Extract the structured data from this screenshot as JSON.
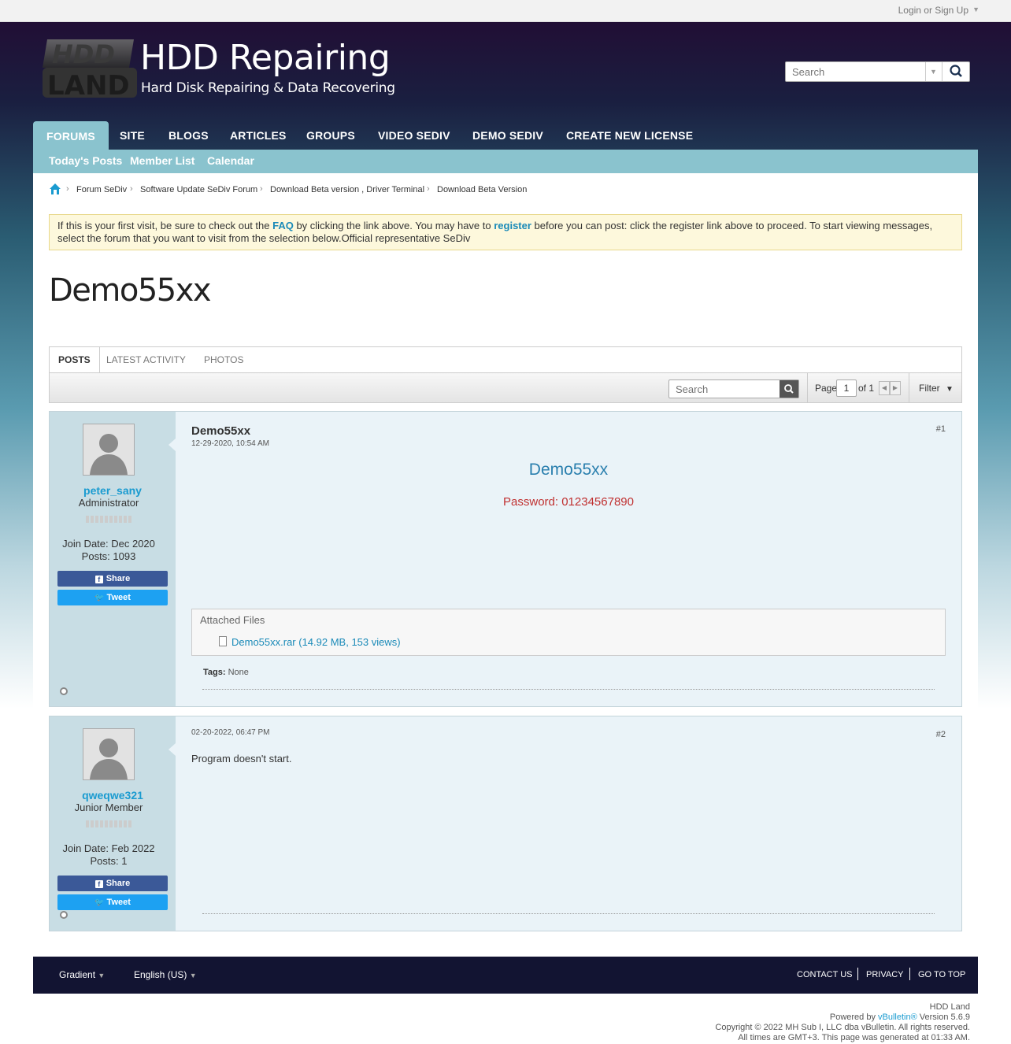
{
  "topbar": {
    "login_label": "Login or Sign Up"
  },
  "header": {
    "title": "HDD Repairing",
    "subtitle": "Hard Disk Repairing & Data Recovering",
    "search_placeholder": "Search"
  },
  "nav": {
    "tabs": [
      "FORUMS",
      "SITE",
      "BLOGS",
      "ARTICLES",
      "GROUPS",
      "VIDEO SEDIV",
      "DEMO SEDIV",
      "CREATE NEW LICENSE"
    ],
    "subtabs": [
      "Today's Posts",
      "Member List",
      "Calendar"
    ]
  },
  "breadcrumb": [
    "Forum SeDiv",
    "Software Update SeDiv Forum",
    "Download Beta version , Driver Terminal",
    "Download Beta Version"
  ],
  "notice": {
    "part1": "If this is your first visit, be sure to check out the ",
    "faq": "FAQ",
    "part2": " by clicking the link above. You may have to ",
    "register": "register",
    "part3": " before you can post: click the register link above to proceed. To start viewing messages, select the forum that you want to visit from the selection below.Official representative SeDiv"
  },
  "page_title": "Demo55xx",
  "tabs": [
    "POSTS",
    "LATEST ACTIVITY",
    "PHOTOS"
  ],
  "toolbar": {
    "search_placeholder": "Search",
    "page_label": "Page",
    "page_value": "1",
    "of_label": "of 1",
    "filter_label": "Filter"
  },
  "posts": [
    {
      "title": "Demo55xx",
      "date": "12-29-2020, 10:54 AM",
      "number": "#1",
      "username": "peter_sany",
      "role": "Administrator",
      "join_date": "Join Date: Dec 2020",
      "posts_count": "Posts: 1093",
      "share": "Share",
      "tweet": "Tweet",
      "content_title": "Demo55xx",
      "content_password": "Password: 01234567890",
      "attached_header": "Attached Files",
      "attached_file": "Demo55xx.rar (14.92 MB, 153 views)",
      "tags_label": "Tags:",
      "tags_value": "None"
    },
    {
      "date": "02-20-2022, 06:47 PM",
      "number": "#2",
      "username": "qweqwe321",
      "role": "Junior Member",
      "join_date": "Join Date: Feb 2022",
      "posts_count": "Posts: 1",
      "share": "Share",
      "tweet": "Tweet",
      "text": "Program doesn't start."
    }
  ],
  "footer": {
    "style": "Gradient",
    "language": "English (US)",
    "links": [
      "CONTACT US",
      "PRIVACY",
      "GO TO TOP"
    ]
  },
  "copyright": {
    "site": "HDD Land",
    "powered_prefix": "Powered by ",
    "powered_link": "vBulletin®",
    "powered_suffix": " Version 5.6.9",
    "copy": "Copyright © 2022 MH Sub I, LLC dba vBulletin. All rights reserved.",
    "times": "All times are GMT+3. This page was generated at 01:33 AM."
  }
}
